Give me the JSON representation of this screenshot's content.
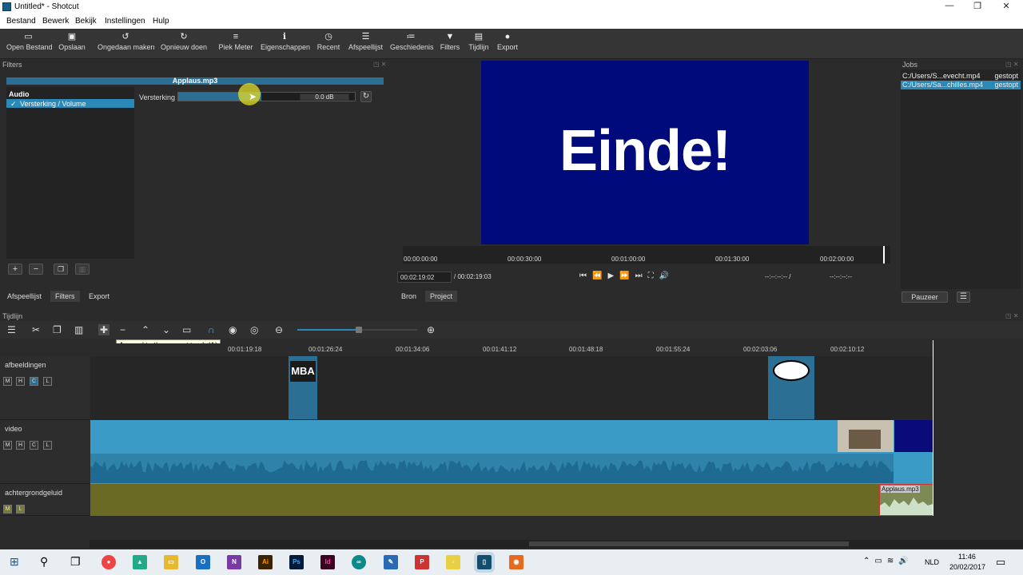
{
  "window": {
    "title": "Untitled* - Shotcut",
    "minimize": "—",
    "restore": "❐",
    "close": "✕"
  },
  "menu": [
    "Bestand",
    "Bewerk",
    "Bekijk",
    "Instellingen",
    "Hulp"
  ],
  "toolbar": [
    {
      "label": "Open Bestand",
      "icon": "folder-open-icon"
    },
    {
      "label": "Opslaan",
      "icon": "save-icon"
    },
    {
      "label": "Ongedaan maken",
      "icon": "undo-icon"
    },
    {
      "label": "Opnieuw doen",
      "icon": "redo-icon"
    },
    {
      "label": "Piek Meter",
      "icon": "meter-icon"
    },
    {
      "label": "Eigenschappen",
      "icon": "info-icon"
    },
    {
      "label": "Recent",
      "icon": "clock-icon"
    },
    {
      "label": "Afspeellijst",
      "icon": "list-icon"
    },
    {
      "label": "Geschiedenis",
      "icon": "history-icon"
    },
    {
      "label": "Filters",
      "icon": "filter-icon"
    },
    {
      "label": "Tijdlijn",
      "icon": "timeline-icon"
    },
    {
      "label": "Export",
      "icon": "export-icon"
    }
  ],
  "filters_panel": {
    "title": "Filters",
    "clip_name": "Applaus.mp3",
    "category": "Audio",
    "item": "Versterking / Volume",
    "param_label": "Versterking",
    "param_value": "0.0 dB",
    "level_fraction": 0.47
  },
  "left_tabs": [
    "Afspeellijst",
    "Filters",
    "Export"
  ],
  "preview": {
    "text": "Einde!",
    "ticks": [
      "00:00:00:00",
      "00:00:30:00",
      "00:01:00:00",
      "00:01:30:00",
      "00:02:00:00"
    ],
    "position": "00:02:19:02",
    "duration": "/ 00:02:19:03",
    "in_point": "--:--:--:-- /",
    "out_point": "--:--:--:--",
    "tabs": [
      "Bron",
      "Project"
    ]
  },
  "jobs": {
    "title": "Jobs",
    "rows": [
      {
        "name": "C:/Users/S...evecht.mp4",
        "status": "gestopt"
      },
      {
        "name": "C:/Users/Sa...chilles.mp4",
        "status": "gestopt"
      }
    ],
    "pause_button": "Pauzeer",
    "menu_icon": "menu-icon"
  },
  "timeline": {
    "title": "Tijdlijn",
    "tooltip": "Append to the current track (A)",
    "ruler": [
      "00:01:19:18",
      "00:01:26:24",
      "00:01:34:06",
      "00:01:41:12",
      "00:01:48:18",
      "00:01:55:24",
      "00:02:03:06",
      "00:02:10:12"
    ],
    "tracks": [
      {
        "name": "afbeeldingen",
        "buttons": [
          "M",
          "H",
          "C",
          "L"
        ]
      },
      {
        "name": "video",
        "buttons": [
          "M",
          "H",
          "C",
          "L"
        ]
      },
      {
        "name": "achtergrondgeluid",
        "buttons": [
          "M",
          "L"
        ]
      }
    ],
    "audio_clip_name": "Applaus.mp3",
    "mba_label": "MBA"
  },
  "taskbar": {
    "lang": "NLD",
    "time": "11:46",
    "date": "20/02/2017"
  },
  "colors": {
    "accent": "#2b89b8",
    "preview_bg": "#000a7a",
    "audio_track": "#6b6a25",
    "video_clip": "#3a9bc6"
  }
}
